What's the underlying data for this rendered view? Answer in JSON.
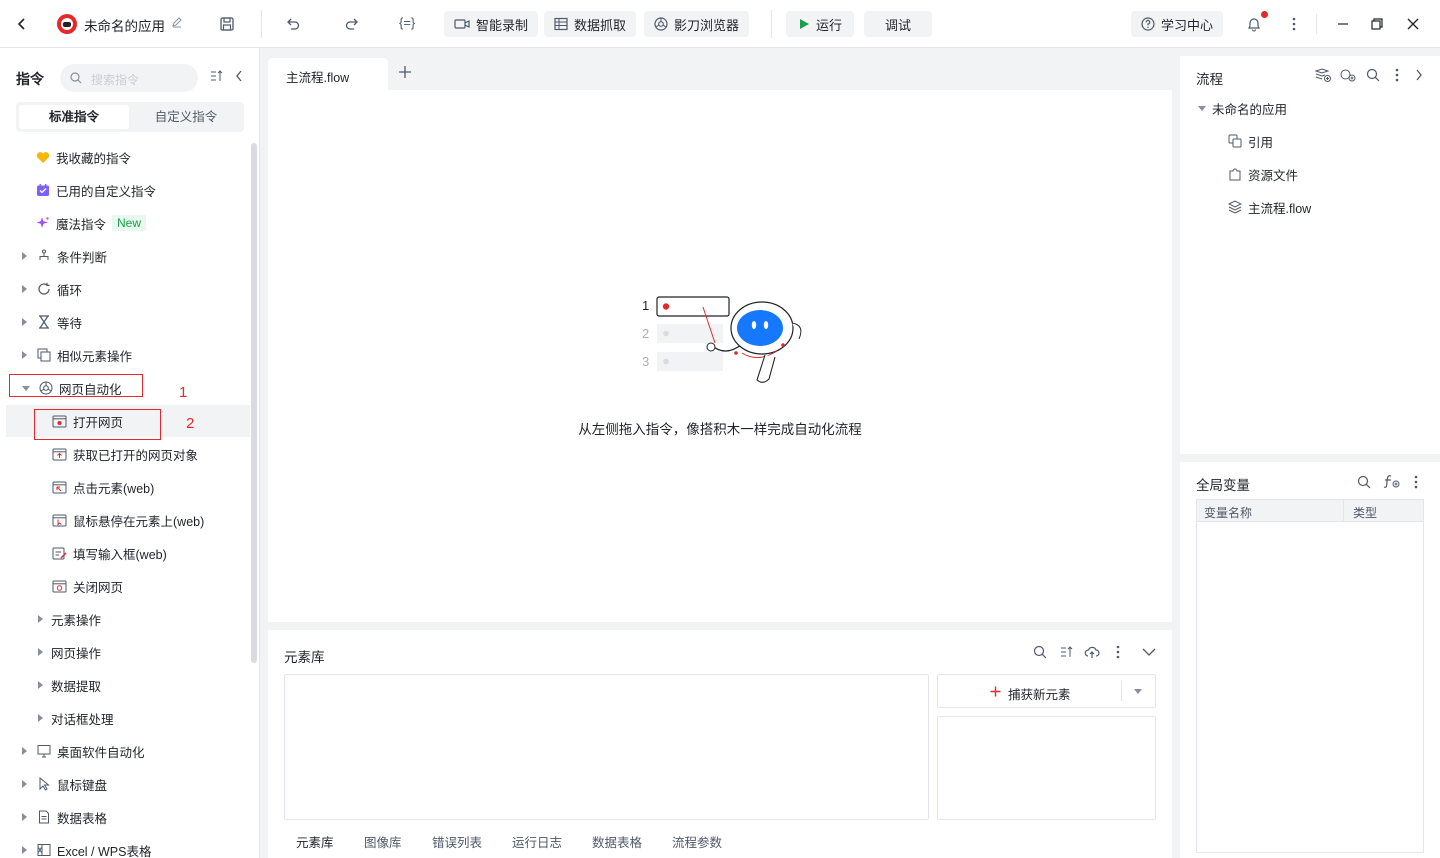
{
  "titlebar": {
    "app_name": "未命名的应用",
    "code_label": "{=}",
    "smart_record": "智能录制",
    "data_grab": "数据抓取",
    "browser": "影刀浏览器",
    "run": "运行",
    "debug": "调试",
    "learn": "学习中心"
  },
  "left": {
    "title": "指令",
    "search_placeholder": "搜索指令",
    "tab_standard": "标准指令",
    "tab_custom": "自定义指令",
    "favorites": "我收藏的指令",
    "used_custom": "已用的自定义指令",
    "magic": "魔法指令",
    "magic_badge": "New",
    "groups": {
      "cond": "条件判断",
      "loop": "循环",
      "wait": "等待",
      "similar": "相似元素操作",
      "web": "网页自动化",
      "desktop": "桌面软件自动化",
      "mouse": "鼠标键盘",
      "sheet": "数据表格",
      "excel": "Excel / WPS表格"
    },
    "web_items": {
      "open": "打开网页",
      "get_opened": "获取已打开的网页对象",
      "click": "点击元素(web)",
      "hover": "鼠标悬停在元素上(web)",
      "fill": "填写输入框(web)",
      "close": "关闭网页"
    },
    "web_sub": {
      "element_ops": "元素操作",
      "page_ops": "网页操作",
      "extract": "数据提取",
      "dialog": "对话框处理"
    },
    "annotations": {
      "one": "1",
      "two": "2"
    }
  },
  "editor": {
    "tab": "主流程.flow",
    "hint": "从左侧拖入指令，像搭积木一样完成自动化流程",
    "illus_nums": [
      "1",
      "2",
      "3"
    ]
  },
  "element_lib": {
    "title": "元素库",
    "capture": "捕获新元素",
    "tabs": [
      "元素库",
      "图像库",
      "错误列表",
      "运行日志",
      "数据表格",
      "流程参数"
    ]
  },
  "flow_panel": {
    "title": "流程",
    "root": "未命名的应用",
    "items": [
      "引用",
      "资源文件",
      "主流程.flow"
    ]
  },
  "vars_panel": {
    "title": "全局变量",
    "col_name": "变量名称",
    "col_type": "类型"
  },
  "colors": {
    "accent": "#1677ff",
    "red": "#e5282a",
    "new_badge_bg": "#e8f8ee",
    "new_badge_text": "#1b9e4b"
  }
}
